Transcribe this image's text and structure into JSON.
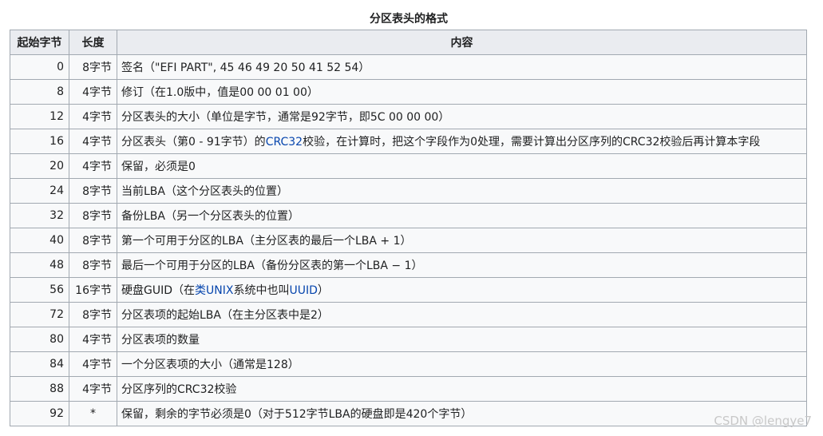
{
  "caption": "分区表头的格式",
  "columns": [
    "起始字节",
    "长度",
    "内容"
  ],
  "rows": [
    {
      "offset": "0",
      "length": "8字节",
      "content": [
        {
          "t": "签名（\"EFI PART\", 45 46 49 20 50 41 52 54）"
        }
      ]
    },
    {
      "offset": "8",
      "length": "4字节",
      "content": [
        {
          "t": "修订（在1.0版中，值是00 00 01 00）"
        }
      ]
    },
    {
      "offset": "12",
      "length": "4字节",
      "content": [
        {
          "t": "分区表头的大小（单位是字节，通常是92字节，即5C 00 00 00）"
        }
      ]
    },
    {
      "offset": "16",
      "length": "4字节",
      "content": [
        {
          "t": "分区表头（第0 - 91字节）的"
        },
        {
          "t": "CRC32",
          "link": true
        },
        {
          "t": "校验，在计算时，把这个字段作为0处理，需要计算出分区序列的CRC32校验后再计算本字段"
        }
      ]
    },
    {
      "offset": "20",
      "length": "4字节",
      "content": [
        {
          "t": "保留，必须是0"
        }
      ]
    },
    {
      "offset": "24",
      "length": "8字节",
      "content": [
        {
          "t": "当前LBA（这个分区表头的位置）"
        }
      ]
    },
    {
      "offset": "32",
      "length": "8字节",
      "content": [
        {
          "t": "备份LBA（另一个分区表头的位置）"
        }
      ]
    },
    {
      "offset": "40",
      "length": "8字节",
      "content": [
        {
          "t": "第一个可用于分区的LBA（主分区表的最后一个LBA + 1）"
        }
      ]
    },
    {
      "offset": "48",
      "length": "8字节",
      "content": [
        {
          "t": "最后一个可用于分区的LBA（备份分区表的第一个LBA − 1）"
        }
      ]
    },
    {
      "offset": "56",
      "length": "16字节",
      "content": [
        {
          "t": "硬盘GUID（在"
        },
        {
          "t": "类UNIX",
          "link": true
        },
        {
          "t": "系统中也叫"
        },
        {
          "t": "UUID",
          "link": true
        },
        {
          "t": "）"
        }
      ]
    },
    {
      "offset": "72",
      "length": "8字节",
      "content": [
        {
          "t": "分区表项的起始LBA（在主分区表中是2）"
        }
      ]
    },
    {
      "offset": "80",
      "length": "4字节",
      "content": [
        {
          "t": "分区表项的数量"
        }
      ]
    },
    {
      "offset": "84",
      "length": "4字节",
      "content": [
        {
          "t": "一个分区表项的大小（通常是128）"
        }
      ]
    },
    {
      "offset": "88",
      "length": "4字节",
      "content": [
        {
          "t": "分区序列的CRC32校验"
        }
      ]
    },
    {
      "offset": "92",
      "length": "*",
      "content": [
        {
          "t": "保留，剩余的字节必须是0（对于512字节LBA的硬盘即是420个字节）"
        }
      ]
    }
  ],
  "watermark": "CSDN @lengye7",
  "colors": {
    "link": "#0645ad",
    "header_bg": "#eaecf0",
    "cell_bg": "#f8f9fa",
    "border": "#a2a9b1"
  }
}
